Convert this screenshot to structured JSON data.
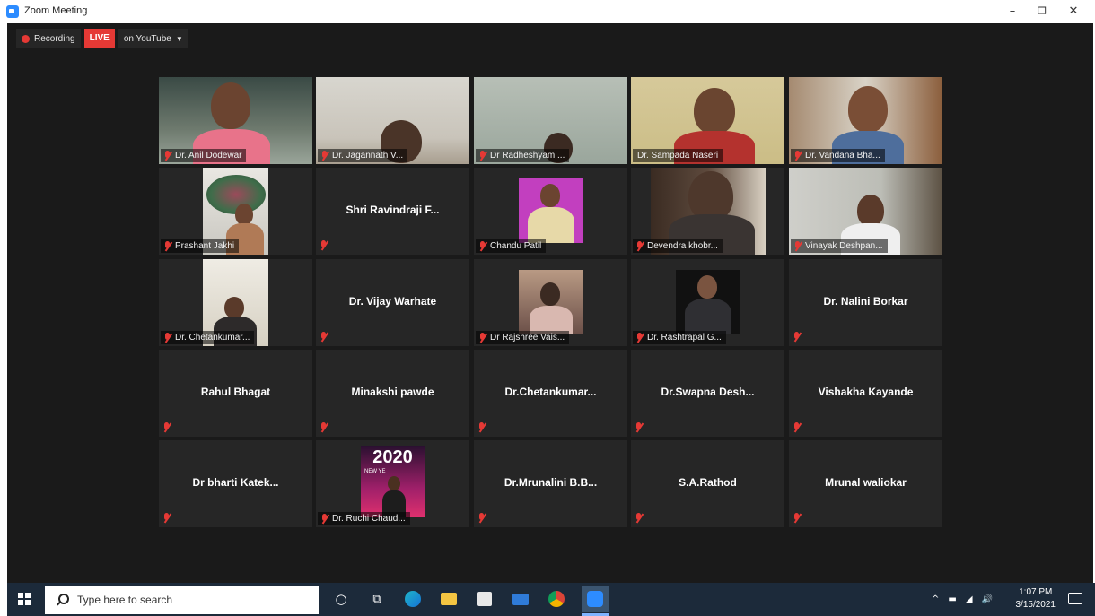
{
  "window": {
    "title": "Zoom Meeting",
    "minimize": "–",
    "restore": "❐",
    "close": "✕"
  },
  "recording": {
    "label": "Recording",
    "live": "LIVE",
    "stream": "on YouTube"
  },
  "tiles": [
    {
      "name": "Dr. Anil Dodewar",
      "video": true
    },
    {
      "name": "Dr. Jagannath V...",
      "video": true
    },
    {
      "name": "Dr Radheshyam ...",
      "video": true
    },
    {
      "name": "Dr. Sampada Naseri",
      "video": true,
      "active": true
    },
    {
      "name": "Dr. Vandana Bha...",
      "video": true
    },
    {
      "name": "Prashant Jakhi",
      "video": true
    },
    {
      "name": "Shri Ravindraji F...",
      "video": false
    },
    {
      "name": "Chandu Patil",
      "video": true
    },
    {
      "name": "Devendra khobr...",
      "video": true
    },
    {
      "name": "Vinayak Deshpan...",
      "video": true
    },
    {
      "name": "Dr. Chetankumar...",
      "video": true
    },
    {
      "name": "Dr. Vijay Warhate",
      "video": false
    },
    {
      "name": "Dr Rajshree Vais...",
      "video": true
    },
    {
      "name": "Dr. Rashtrapal G...",
      "video": true
    },
    {
      "name": "Dr. Nalini Borkar",
      "video": false
    },
    {
      "name": "Rahul Bhagat",
      "video": false
    },
    {
      "name": "Minakshi pawde",
      "video": false
    },
    {
      "name": "Dr.Chetankumar...",
      "video": false
    },
    {
      "name": "Dr.Swapna Desh...",
      "video": false
    },
    {
      "name": "Vishakha Kayande",
      "video": false
    },
    {
      "name": "Dr bharti Katek...",
      "video": false
    },
    {
      "name": "Dr. Ruchi Chaud...",
      "video": true
    },
    {
      "name": "Dr.Mrunalini B.B...",
      "video": false
    },
    {
      "name": "S.A.Rathod",
      "video": false
    },
    {
      "name": "Mrunal waliokar",
      "video": false
    }
  ],
  "ruchi_poster": {
    "year": "2020",
    "tagline": "NEW YE"
  },
  "taskbar": {
    "search_placeholder": "Type here to search",
    "icons": [
      "cortana-icon",
      "task-view-icon",
      "edge-icon",
      "file-explorer-icon",
      "store-icon",
      "mail-icon",
      "chrome-icon",
      "zoom-icon"
    ],
    "time": "1:07 PM",
    "date": "3/15/2021"
  },
  "colors": {
    "live_red": "#e53935",
    "active_border": "#c6d94a",
    "taskbar": "#1c2a3a",
    "tile_bg": "#262626"
  }
}
